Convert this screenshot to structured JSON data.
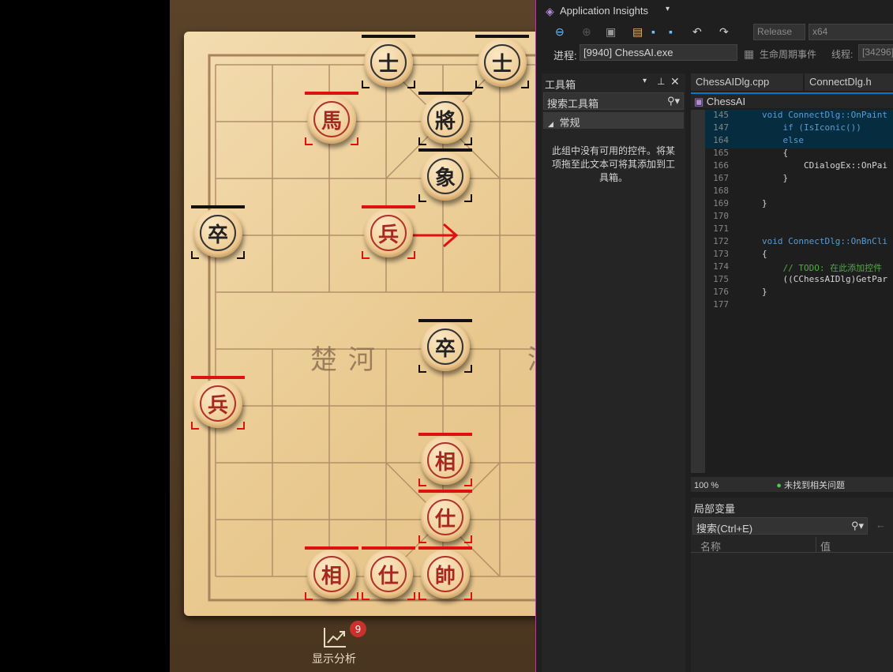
{
  "chess": {
    "river_left": "楚河",
    "river_right": "漢",
    "pieces": [
      {
        "label": "士",
        "side": "black"
      },
      {
        "label": "士",
        "side": "black"
      },
      {
        "label": "馬",
        "side": "red"
      },
      {
        "label": "將",
        "side": "black"
      },
      {
        "label": "象",
        "side": "black"
      },
      {
        "label": "卒",
        "side": "black"
      },
      {
        "label": "兵",
        "side": "red"
      },
      {
        "label": "卒",
        "side": "black"
      },
      {
        "label": "兵",
        "side": "red"
      },
      {
        "label": "相",
        "side": "red"
      },
      {
        "label": "仕",
        "side": "red"
      },
      {
        "label": "相",
        "side": "red"
      },
      {
        "label": "仕",
        "side": "red"
      },
      {
        "label": "帥",
        "side": "red"
      }
    ],
    "analysis_label": "显示分析",
    "analysis_badge": "9",
    "colors": {
      "red_marker": "#e01010",
      "black_marker": "#111111",
      "move_arrow": "#e01010"
    }
  },
  "vs": {
    "app_insights": "Application Insights",
    "config": "Release",
    "platform": "x64",
    "process_label": "进程:",
    "process_value": "[9940] ChessAI.exe",
    "lifecycle": "生命周期事件",
    "thread_label": "线程:",
    "thread_value": "[34296]",
    "toolbox": {
      "title": "工具箱",
      "search_placeholder": "搜索工具箱",
      "group": "常规",
      "empty_msg": "此组中没有可用的控件。将某项拖至此文本可将其添加到工具箱。"
    },
    "tabs": [
      "ChessAIDlg.cpp",
      "ConnectDlg.h"
    ],
    "nav_class": "ChessAI",
    "code": [
      {
        "n": "145",
        "t": "void ConnectDlg::OnPaint"
      },
      {
        "n": "147",
        "t": "    if (IsIconic())"
      },
      {
        "n": "164",
        "t": "    else"
      },
      {
        "n": "165",
        "t": "    {"
      },
      {
        "n": "166",
        "t": "        CDialogEx::OnPai"
      },
      {
        "n": "167",
        "t": "    }"
      },
      {
        "n": "168",
        "t": ""
      },
      {
        "n": "169",
        "t": "}"
      },
      {
        "n": "170",
        "t": ""
      },
      {
        "n": "171",
        "t": ""
      },
      {
        "n": "172",
        "t": "void ConnectDlg::OnBnCli"
      },
      {
        "n": "173",
        "t": "{"
      },
      {
        "n": "174",
        "t": "    // TODO: 在此添加控件"
      },
      {
        "n": "175",
        "t": "    ((CChessAIDlg)GetPar"
      },
      {
        "n": "176",
        "t": "}"
      },
      {
        "n": "177",
        "t": ""
      }
    ],
    "zoom": "100 %",
    "issues": "未找到相关问题",
    "locals": {
      "title": "局部变量",
      "search_placeholder": "搜索(Ctrl+E)",
      "col_name": "名称",
      "col_value": "值"
    }
  }
}
